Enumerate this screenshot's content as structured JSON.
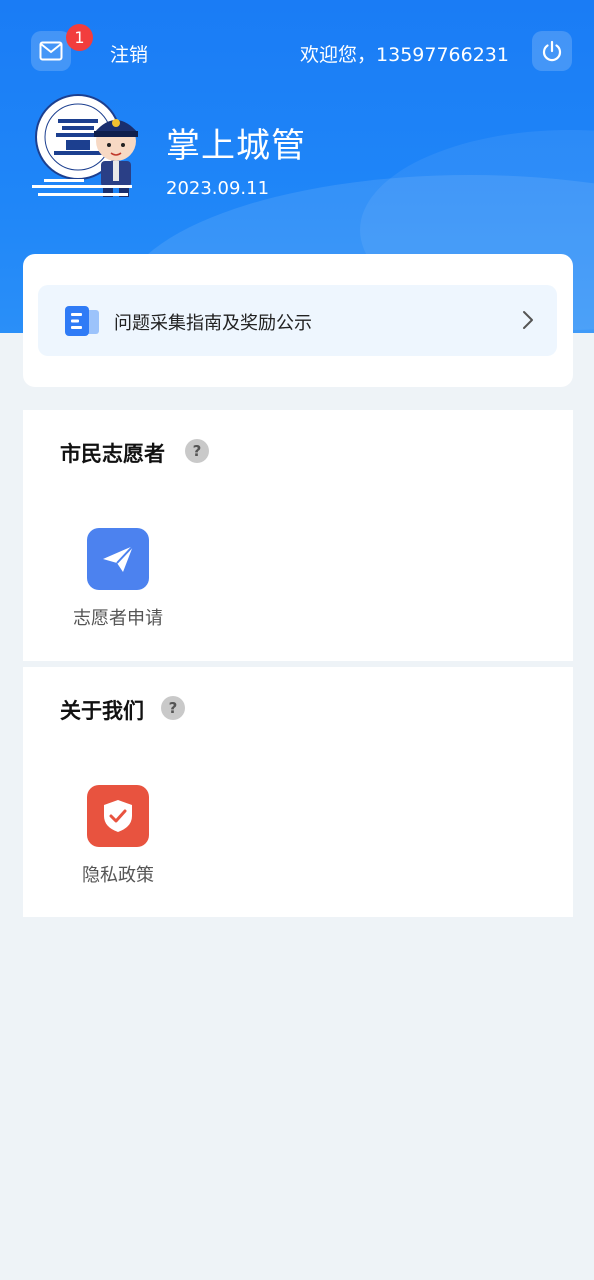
{
  "header": {
    "mail_badge_count": "1",
    "logout_label": "注销",
    "welcome_text": "欢迎您，13597766231",
    "app_title": "掌上城管",
    "date": "2023.09.11",
    "colors": {
      "primary": "#1a7cf5",
      "badge": "#f23d3d"
    }
  },
  "guide": {
    "label": "问题采集指南及奖励公示",
    "icon": "document-icon"
  },
  "sections": [
    {
      "title": "市民志愿者",
      "help_icon": "?",
      "items": [
        {
          "label": "志愿者申请",
          "icon": "paper-plane-icon",
          "color": "#4c82ef"
        }
      ]
    },
    {
      "title": "关于我们",
      "help_icon": "?",
      "items": [
        {
          "label": "隐私政策",
          "icon": "shield-check-icon",
          "color": "#e8533f"
        }
      ]
    }
  ]
}
